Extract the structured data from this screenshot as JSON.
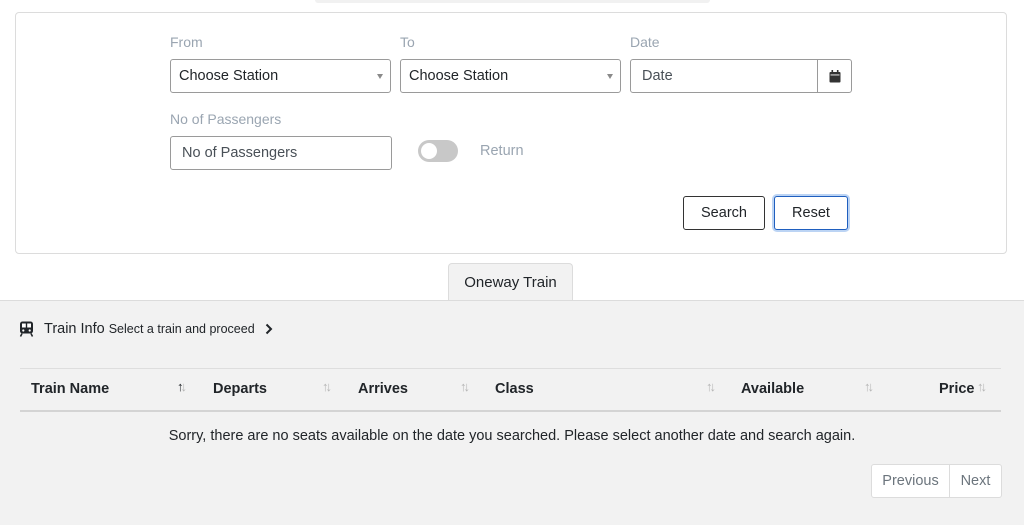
{
  "search_form": {
    "from": {
      "label": "From",
      "value": "Choose Station"
    },
    "to": {
      "label": "To",
      "value": "Choose Station"
    },
    "date": {
      "label": "Date",
      "placeholder": "Date"
    },
    "passengers": {
      "label": "No of Passengers",
      "placeholder": "No of Passengers"
    },
    "return_toggle": {
      "label": "Return",
      "checked": false
    },
    "search_label": "Search",
    "reset_label": "Reset"
  },
  "tabs": [
    {
      "label": "Oneway Train",
      "active": true
    }
  ],
  "train_info": {
    "title": "Train Info",
    "subtitle": "Select a train and proceed"
  },
  "table": {
    "columns": [
      {
        "label": "Train Name",
        "sort": "ascending"
      },
      {
        "label": "Departs",
        "sort": "none"
      },
      {
        "label": "Arrives",
        "sort": "none"
      },
      {
        "label": "Class",
        "sort": "none"
      },
      {
        "label": "Available",
        "sort": "none"
      },
      {
        "label": "Price",
        "sort": "none"
      }
    ],
    "empty_message": "Sorry, there are no seats available on the date you searched. Please select another date and search again."
  },
  "pagination": {
    "previous_label": "Previous",
    "next_label": "Next"
  },
  "icons": {
    "date_picker": "calendar-icon",
    "train_info": "train-icon",
    "proceed": "chevron-right-icon",
    "sort": "sort-arrows-icon"
  },
  "colors": {
    "label": "#9aa5b1",
    "focus_border": "#1f5fbf",
    "panel_bg": "#f2f2f2"
  }
}
